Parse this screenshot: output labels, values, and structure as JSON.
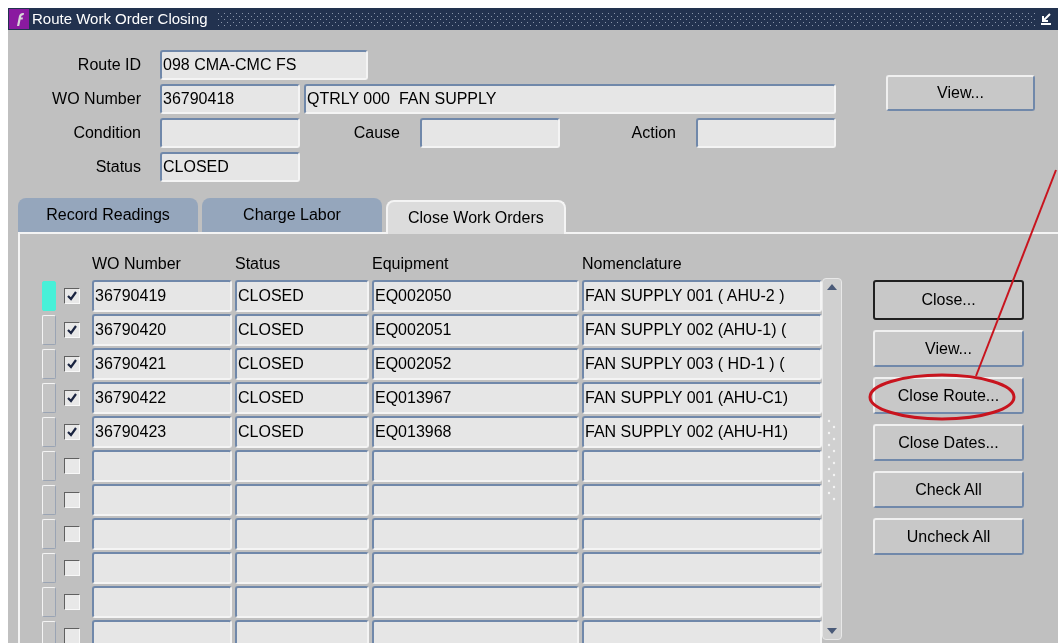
{
  "window": {
    "title": "Route Work Order Closing"
  },
  "form": {
    "route_id": {
      "label": "Route ID",
      "value": "098 CMA-CMC FS"
    },
    "wo_number": {
      "label": "WO Number",
      "value": "36790418",
      "description": "QTRLY 000  FAN SUPPLY"
    },
    "condition": {
      "label": "Condition"
    },
    "cause": {
      "label": "Cause"
    },
    "action": {
      "label": "Action"
    },
    "status": {
      "label": "Status",
      "value": "CLOSED"
    },
    "view_button": "View..."
  },
  "tabs": [
    {
      "label": "Record Readings",
      "selected": false
    },
    {
      "label": "Charge Labor",
      "selected": false
    },
    {
      "label": "Close Work Orders",
      "selected": true
    }
  ],
  "table": {
    "columns": [
      "WO Number",
      "Status",
      "Equipment",
      "Nomenclature"
    ],
    "rows": [
      {
        "current": true,
        "checked": true,
        "wo_number": "36790419",
        "status": "CLOSED",
        "equipment": "EQ002050",
        "nomenclature": "FAN SUPPLY 001 ( AHU-2 )"
      },
      {
        "current": false,
        "checked": true,
        "wo_number": "36790420",
        "status": "CLOSED",
        "equipment": "EQ002051",
        "nomenclature": "FAN SUPPLY 002 (AHU-1) ("
      },
      {
        "current": false,
        "checked": true,
        "wo_number": "36790421",
        "status": "CLOSED",
        "equipment": "EQ002052",
        "nomenclature": "FAN SUPPLY 003 ( HD-1 ) ("
      },
      {
        "current": false,
        "checked": true,
        "wo_number": "36790422",
        "status": "CLOSED",
        "equipment": "EQ013967",
        "nomenclature": "FAN SUPPLY 001 (AHU-C1)"
      },
      {
        "current": false,
        "checked": true,
        "wo_number": "36790423",
        "status": "CLOSED",
        "equipment": "EQ013968",
        "nomenclature": "FAN SUPPLY 002 (AHU-H1)"
      },
      {
        "current": false,
        "checked": false
      },
      {
        "current": false,
        "checked": false
      },
      {
        "current": false,
        "checked": false
      },
      {
        "current": false,
        "checked": false
      },
      {
        "current": false,
        "checked": false
      },
      {
        "current": false,
        "checked": false
      }
    ]
  },
  "buttons": [
    {
      "label": "Close...",
      "default": true
    },
    {
      "label": "View...",
      "default": false
    },
    {
      "label": "Close Route...",
      "default": false
    },
    {
      "label": "Close Dates...",
      "default": false
    },
    {
      "label": "Check All",
      "default": false
    },
    {
      "label": "Uncheck All",
      "default": false
    }
  ]
}
